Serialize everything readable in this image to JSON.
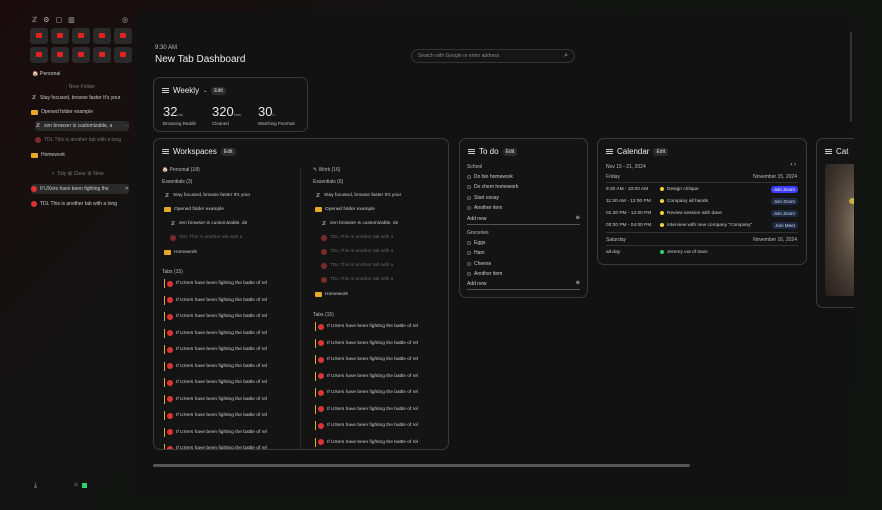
{
  "sidebar": {
    "personal_label": "Personal",
    "new_folder": "New Folder",
    "items": [
      {
        "label": "Stay focused, browse faster It's your"
      },
      {
        "label": "Opened folder example"
      },
      {
        "label": "zen browser is customizable, a"
      },
      {
        "label": "TDL This is another tab with a long"
      },
      {
        "label": "Homework"
      }
    ],
    "tidy": "Tidy",
    "clear": "Clear",
    "new": "New",
    "tabs": [
      {
        "label": "If UXers have been fighting the"
      },
      {
        "label": "TDL This is another tab with a long"
      }
    ]
  },
  "header": {
    "time": "9:30 AM",
    "title": "New Tab Dashboard",
    "search_placeholder": "Search with Google or enter address"
  },
  "weekly": {
    "title": "Weekly",
    "edit": "Edit",
    "stats": [
      {
        "value": "32",
        "unit": "hrs",
        "label": "Browsing Reddit"
      },
      {
        "value": "320",
        "unit": "kms",
        "label": "Cleaned"
      },
      {
        "value": "30",
        "unit": "h",
        "label": "Watching Pornhub"
      }
    ]
  },
  "workspaces": {
    "title": "Workspaces",
    "edit": "Edit",
    "col1": {
      "header": "Personal (18)",
      "essentials": "Essentials (3)",
      "items": [
        "Stay focused, browse faster It's your",
        "Opened folder example",
        "zen browser is customizable, de",
        "TDL This is another tab with a",
        "Homework"
      ],
      "tabs_header": "Tabs (15)",
      "tab_label": "If UXers have been fighting the battle of rel"
    },
    "col2": {
      "header": "Work (16)",
      "essentials": "Essentials (6)",
      "items": [
        "Stay focused, browse faster It's your",
        "Opened folder example",
        "zen browser is customizable, de",
        "TDL This is another tab with a",
        "TDL This is another tab with a",
        "TDL This is another tab with a",
        "TDL This is another tab with a",
        "Homework"
      ],
      "tabs_header": "Tabs (15)",
      "tab_label": "If UXers have been fighting the battle of rel"
    }
  },
  "todo": {
    "title": "To do",
    "edit": "Edit",
    "school_label": "School",
    "school": [
      "Do bio homework",
      "Do chem homework",
      "Start essay",
      "Another item"
    ],
    "groceries_label": "Groceries",
    "groceries": [
      "Eggs",
      "Ham",
      "Cheese",
      "Another item"
    ],
    "add_new": "Add new"
  },
  "calendar": {
    "title": "Calendar",
    "edit": "Edit",
    "range": "Nov 15 - 21, 2024",
    "day1": "Friday",
    "date1": "November 15, 2024",
    "events": [
      {
        "time": "9:30 AM - 10:00 AM",
        "title": "Design critique",
        "action": "Join Zoom"
      },
      {
        "time": "11:30 AM - 12:00 PM",
        "title": "Company all hands",
        "action": "Join Zoom"
      },
      {
        "time": "01:30 PM - 12:00 PM",
        "title": "Review session with dave",
        "action": "Join Zoom"
      },
      {
        "time": "03:30 PM - 04:00 PM",
        "title": "Interview with new company \"Company\"",
        "action": "Join Meet"
      }
    ],
    "day2": "Saturday",
    "date2": "November 16, 2024",
    "allday_label": "all-day",
    "allday_event": "Jeremy out of town"
  },
  "cat": {
    "title": "Cat"
  },
  "colors": {
    "accent": "#e52222",
    "folder": "#e8a92a",
    "yellow": "#f2d43a",
    "green": "#2fd36b"
  }
}
